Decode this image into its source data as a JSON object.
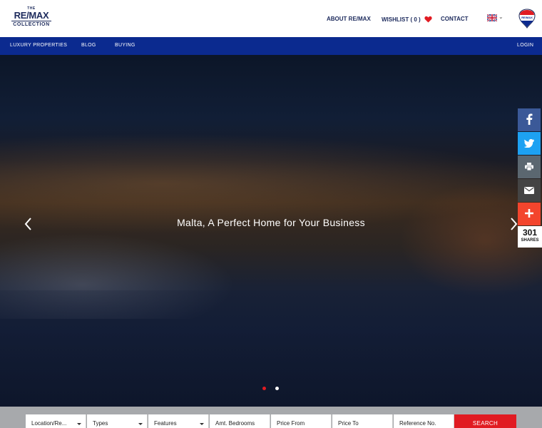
{
  "header": {
    "logo": {
      "the": "THE",
      "brand": "RE/MAX",
      "collection": "COLLECTION"
    },
    "about": "ABOUT RE/MAX",
    "wishlist": "WISHLIST ( 0 )",
    "contact": "CONTACT",
    "language_icon": "uk-flag-icon",
    "brand_icon": "remax-balloon-icon"
  },
  "nav": {
    "luxury": "LUXURY PROPERTIES",
    "blog": "BLOG",
    "buying": "BUYING",
    "login": "LOGIN"
  },
  "hero": {
    "caption": "Malta, A Perfect Home for Your Business",
    "prev_icon": "chevron-left-icon",
    "next_icon": "chevron-right-icon",
    "slides_count": 2,
    "active_slide": 1
  },
  "share": {
    "count": "301",
    "label": "SHARES",
    "colors": {
      "facebook": "#3b5998",
      "twitter": "#1da1f2",
      "print": "#5b6770",
      "email": "#444444",
      "more": "#f3452d"
    }
  },
  "search": {
    "location": "Location/Re...",
    "types": "Types",
    "features": "Features",
    "bedrooms": "Amt. Bedrooms",
    "price_from": "Price From",
    "price_to": "Price To",
    "reference": "Reference No.",
    "button": "SEARCH"
  },
  "colors": {
    "brand_blue": "#0b2a8f",
    "brand_red": "#e11b22",
    "navy_text": "#1c2a5c"
  }
}
